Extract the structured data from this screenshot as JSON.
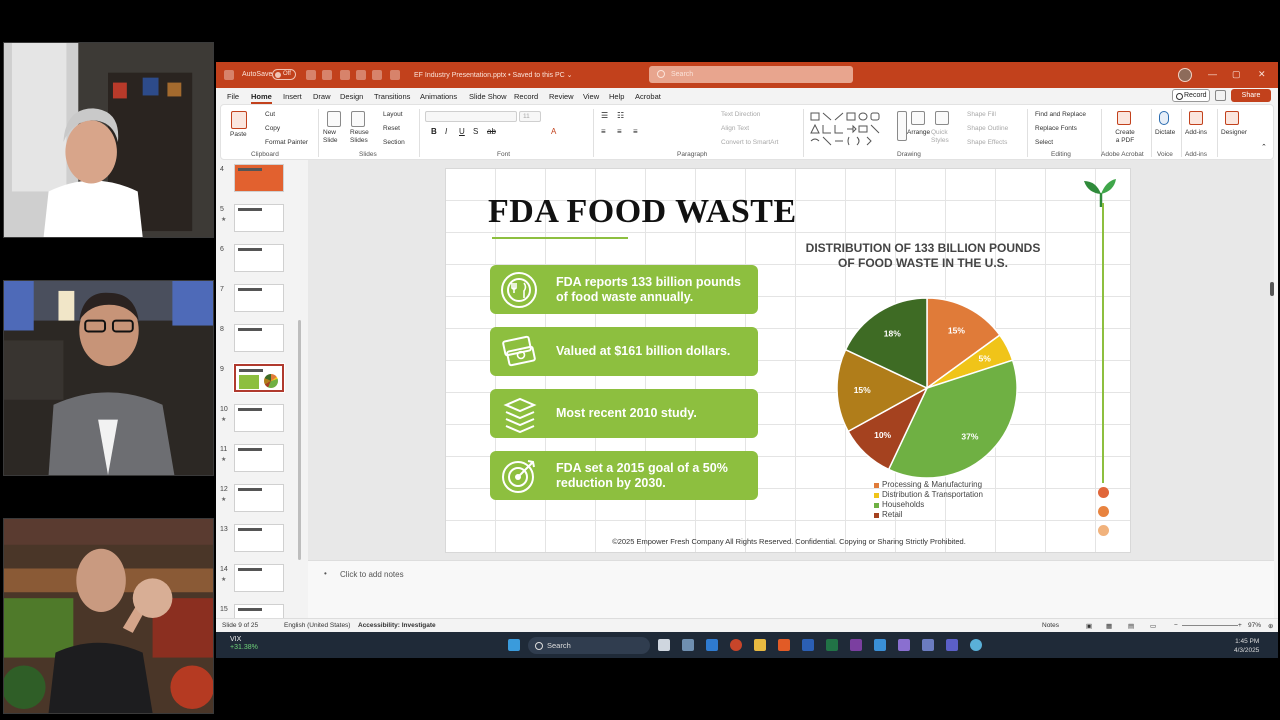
{
  "titlebar": {
    "autosave_label": "AutoSave",
    "autosave_state": "Off",
    "file_name": "EF Industry Presentation.pptx • Saved to this PC ⌄",
    "search_placeholder": "Search"
  },
  "menu": {
    "tabs": [
      "File",
      "Home",
      "Insert",
      "Draw",
      "Design",
      "Transitions",
      "Animations",
      "Slide Show",
      "Record",
      "Review",
      "View",
      "Help",
      "Acrobat"
    ],
    "record_label": "Record",
    "share_label": "Share"
  },
  "ribbon": {
    "clipboard": {
      "paste": "Paste",
      "cut": "Cut",
      "copy": "Copy",
      "format_painter": "Format Painter",
      "label": "Clipboard"
    },
    "slides": {
      "new_slide": "New Slide",
      "reuse_slides": "Reuse Slides",
      "layout": "Layout",
      "reset": "Reset",
      "section": "Section",
      "label": "Slides"
    },
    "font": {
      "size": "11",
      "label": "Font"
    },
    "paragraph": {
      "text_direction": "Text Direction",
      "align_text": "Align Text",
      "convert_smartart": "Convert to SmartArt",
      "label": "Paragraph"
    },
    "drawing": {
      "arrange": "Arrange",
      "quick_styles": "Quick Styles",
      "shape_fill": "Shape Fill",
      "shape_outline": "Shape Outline",
      "shape_effects": "Shape Effects",
      "label": "Drawing"
    },
    "editing": {
      "find_replace": "Find and Replace",
      "replace_fonts": "Replace Fonts",
      "select": "Select",
      "label": "Editing"
    },
    "acrobat": {
      "create_pdf": "Create a PDF",
      "label": "Adobe Acrobat"
    },
    "voice": {
      "dictate": "Dictate",
      "label": "Voice"
    },
    "addins": {
      "addins": "Add-ins",
      "label": "Add-ins"
    },
    "designer": {
      "designer": "Designer"
    }
  },
  "thumbnails": [
    {
      "num": "4",
      "star": false
    },
    {
      "num": "5",
      "star": true
    },
    {
      "num": "6",
      "star": false
    },
    {
      "num": "7",
      "star": false
    },
    {
      "num": "8",
      "star": false
    },
    {
      "num": "9",
      "star": false
    },
    {
      "num": "10",
      "star": true
    },
    {
      "num": "11",
      "star": true
    },
    {
      "num": "12",
      "star": true
    },
    {
      "num": "13",
      "star": false
    },
    {
      "num": "14",
      "star": true
    },
    {
      "num": "15",
      "star": false
    }
  ],
  "slide": {
    "title": "FDA FOOD WASTE",
    "cards": [
      {
        "icon": "plate-icon",
        "text": "FDA reports 133 billion pounds of food waste annually."
      },
      {
        "icon": "money-icon",
        "text": "Valued at $161 billion dollars."
      },
      {
        "icon": "books-icon",
        "text": "Most recent 2010 study."
      },
      {
        "icon": "target-icon",
        "text": "FDA set a 2015 goal of a 50% reduction by 2030."
      }
    ],
    "footer": "©2025 Empower Fresh Company All Rights Reserved. Confidential. Copying or Sharing Strictly Prohibited.",
    "accent_color": "#8dbf3f",
    "dot_colors": [
      "#e0663a",
      "#e8833f",
      "#f1b27c"
    ]
  },
  "chart_data": {
    "type": "pie",
    "title": "DISTRIBUTION OF 133 BILLION POUNDS OF FOOD WASTE IN THE U.S.",
    "slices": [
      {
        "label": "15%",
        "value": 15,
        "color": "#e07b39"
      },
      {
        "label": "5%",
        "value": 5,
        "color": "#f0c419"
      },
      {
        "label": "37%",
        "value": 37,
        "color": "#6fb043"
      },
      {
        "label": "10%",
        "value": 10,
        "color": "#a5421f"
      },
      {
        "label": "15%",
        "value": 15,
        "color": "#b07d1a"
      },
      {
        "label": "18%",
        "value": 18,
        "color": "#3e6b24"
      }
    ],
    "legend": [
      {
        "name": "Processing & Manufacturing",
        "color": "#e07b39"
      },
      {
        "name": "Distribution & Transportation",
        "color": "#f0c419"
      },
      {
        "name": "Households",
        "color": "#6fb043"
      },
      {
        "name": "Retail",
        "color": "#a5421f"
      }
    ],
    "legend_position": "bottom"
  },
  "notes": {
    "placeholder": "Click to add notes"
  },
  "status": {
    "slide": "Slide 9 of 25",
    "language": "English (United States)",
    "accessibility": "Accessibility: Investigate",
    "notes": "Notes",
    "zoom": "97%"
  },
  "taskbar": {
    "ticker": "VIX",
    "change": "+31.38%",
    "search": "Search",
    "time": "1:45 PM",
    "date": "4/3/2025"
  }
}
